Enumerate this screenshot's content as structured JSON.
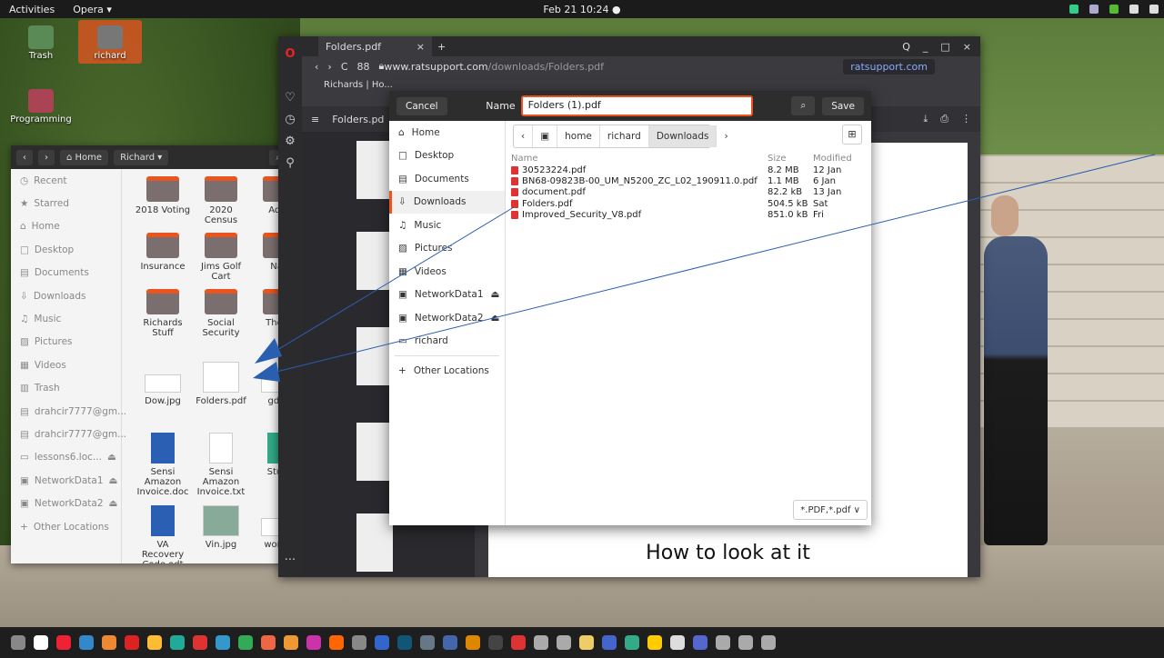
{
  "topbar": {
    "activities": "Activities",
    "app": "Opera ▾",
    "clock": "Feb 21  10:24  ●"
  },
  "desktop": {
    "icons": [
      {
        "label": "Trash"
      },
      {
        "label": "richard"
      },
      {
        "label": "Programming"
      }
    ]
  },
  "files": {
    "header": {
      "home": "Home",
      "location": "Richard",
      "location_arrow": "▾"
    },
    "sidebar": [
      "Recent",
      "Starred",
      "Home",
      "Desktop",
      "Documents",
      "Downloads",
      "Music",
      "Pictures",
      "Videos",
      "Trash",
      "drahcir7777@gm...",
      "drahcir7777@gm...",
      "lessons6.loc...",
      "NetworkData1",
      "NetworkData2",
      "Other Locations"
    ],
    "items": [
      {
        "label": "2018 Voting"
      },
      {
        "label": "2020 Census"
      },
      {
        "label": "Addr"
      },
      {
        "label": "Insurance"
      },
      {
        "label": "Jims Golf Cart"
      },
      {
        "label": "Nav"
      },
      {
        "label": "Richards Stuff"
      },
      {
        "label": "Social Security"
      },
      {
        "label": "The O"
      },
      {
        "label": "Dow.jpg"
      },
      {
        "label": "Folders.pdf"
      },
      {
        "label": "gdp.j"
      },
      {
        "label": "Sensi Amazon Invoice.doc"
      },
      {
        "label": "Sensi Amazon Invoice.txt"
      },
      {
        "label": "Stuff."
      },
      {
        "label": "VA Recovery Code.odt"
      },
      {
        "label": "Vin.jpg"
      },
      {
        "label": "workin"
      }
    ]
  },
  "browser": {
    "tab_title": "Folders.pdf",
    "tab_close": "×",
    "new_tab": "+",
    "url_host": "www.ratsupport.com",
    "url_path": "/downloads/Folders.pdf",
    "bookmark": "Richards | Ho...",
    "account": "ratsupport.com",
    "toolbar_label": "Folders.pd",
    "pdf_caption": "How to look at it",
    "window_controls": [
      "Q",
      "_",
      "□",
      "×"
    ]
  },
  "dialog": {
    "cancel": "Cancel",
    "name_label": "Name",
    "filename": "Folders (1).pdf",
    "save": "Save",
    "places": [
      "Home",
      "Desktop",
      "Documents",
      "Downloads",
      "Music",
      "Pictures",
      "Videos",
      "NetworkData1",
      "NetworkData2",
      "richard",
      "Other Locations"
    ],
    "crumbs": [
      "home",
      "richard",
      "Downloads"
    ],
    "columns": {
      "name": "Name",
      "size": "Size",
      "modified": "Modified"
    },
    "files": [
      {
        "name": "30523224.pdf",
        "size": "8.2 MB",
        "modified": "12 Jan"
      },
      {
        "name": "BN68-09823B-00_UM_N5200_ZC_L02_190911.0.pdf",
        "size": "1.1 MB",
        "modified": "6 Jan"
      },
      {
        "name": "document.pdf",
        "size": "82.2 kB",
        "modified": "13 Jan"
      },
      {
        "name": "Folders.pdf",
        "size": "504.5 kB",
        "modified": "Sat"
      },
      {
        "name": "Improved_Security_V8.pdf",
        "size": "851.0 kB",
        "modified": "Fri"
      }
    ],
    "filter": "*.PDF,*.pdf ∨"
  },
  "colors": {
    "accent": "#e9541f",
    "dock_icons": [
      "#888",
      "#fff",
      "#e23",
      "#38c",
      "#e83",
      "#d22",
      "#fb3",
      "#2a9",
      "#d33",
      "#39c",
      "#3a5",
      "#e64",
      "#e93",
      "#c3a",
      "#f60",
      "#888",
      "#36c",
      "#157",
      "#678",
      "#46a",
      "#d80",
      "#444",
      "#d33",
      "#aaa",
      "#aaa",
      "#ec6",
      "#46c",
      "#3a8",
      "#fc0",
      "#ddd",
      "#56c",
      "#aaa",
      "#aaa",
      "#aaa"
    ]
  }
}
